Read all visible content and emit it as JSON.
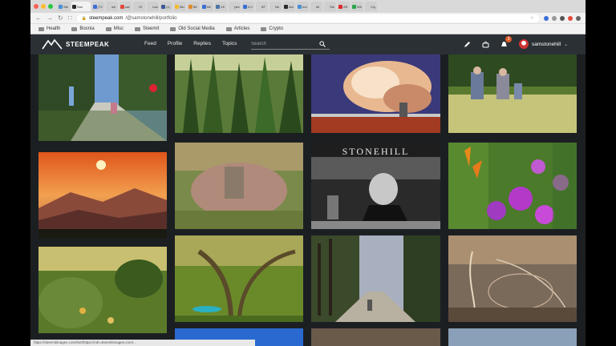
{
  "browser": {
    "tabs": [
      {
        "label": "Ste",
        "color": "#4a90d9"
      },
      {
        "label": "San",
        "color": "#2b2b2b",
        "active": true
      },
      {
        "label": "(72",
        "color": "#3b6fd6"
      },
      {
        "label": "wh",
        "color": "#cfcfcf"
      },
      {
        "label": "san",
        "color": "#e04a3a"
      },
      {
        "label": "Hi",
        "color": "#cfcfcf"
      },
      {
        "label": "Lad",
        "color": "#cfcfcf"
      },
      {
        "label": "(1)",
        "color": "#3b5998"
      },
      {
        "label": "Bin",
        "color": "#f3ba2f"
      },
      {
        "label": "$0.",
        "color": "#e08a2a"
      },
      {
        "label": "Bit",
        "color": "#3b6fd6"
      },
      {
        "label": "VK",
        "color": "#4a76a8"
      },
      {
        "label": "(ste",
        "color": "#cfcfcf"
      },
      {
        "label": "0.0",
        "color": "#3b6fd6"
      },
      {
        "label": "BT",
        "color": "#cfcfcf"
      },
      {
        "label": "Ne",
        "color": "#cfcfcf"
      },
      {
        "label": "Ast",
        "color": "#2b2b2b"
      },
      {
        "label": "Ind",
        "color": "#4a90d9"
      },
      {
        "label": "htt",
        "color": "#cfcfcf"
      },
      {
        "label": "Ste",
        "color": "#cfcfcf"
      },
      {
        "label": "AR",
        "color": "#e02a2a"
      },
      {
        "label": "Wh",
        "color": "#2aa84a"
      },
      {
        "label": "Cry",
        "color": "#cfcfcf"
      }
    ],
    "url_host": "steempeak.com",
    "url_path": "/@samstonehill/portfolio",
    "bookmarks": [
      "Health",
      "Bosnia",
      "Misc",
      "Steemit",
      "Old Social Media",
      "Articles",
      "Crypto"
    ]
  },
  "site": {
    "logo": "STEEMPEAK",
    "nav": [
      "Feed",
      "Profile",
      "Replies",
      "Topics"
    ],
    "search_placeholder": "Search",
    "notification_count": "3",
    "username": "samstonehill"
  },
  "photo_overlay_text": "STONEHILL",
  "status_url": "https://steemitimages.com/0x0/https://cdn.steemitimages.com/..."
}
